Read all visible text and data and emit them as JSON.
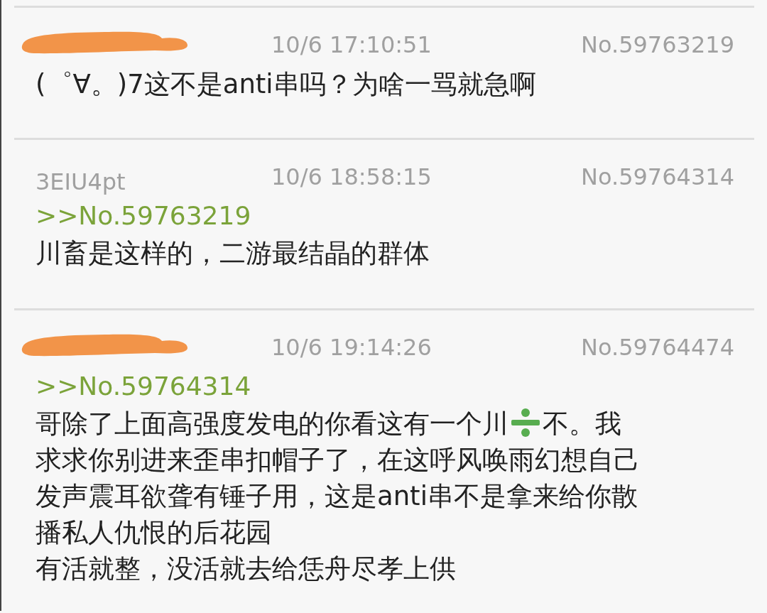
{
  "posts": [
    {
      "author": {
        "redacted": true
      },
      "time": "10/6 17:10:51",
      "number": "No.59763219",
      "lines": [
        [
          {
            "kind": "text",
            "text": "(゜∀。)7这不是anti串吗？为啥一骂就急啊"
          }
        ]
      ]
    },
    {
      "author": {
        "redacted": false,
        "name": "3EIU4pt"
      },
      "time": "10/6 18:58:15",
      "number": "No.59764314",
      "reply_to": ">>No.59763219",
      "lines": [
        [
          {
            "kind": "text",
            "text": "川畜是这样的，二游最结晶的群体"
          }
        ]
      ]
    },
    {
      "author": {
        "redacted": true
      },
      "time": "10/6 19:14:26",
      "number": "No.59764474",
      "reply_to": ">>No.59764314",
      "lines": [
        [
          {
            "kind": "text",
            "text": "哥除了上面高强度发电的你看这有一个川"
          },
          {
            "kind": "divide-emoji"
          },
          {
            "kind": "text",
            "text": "不。我"
          }
        ],
        [
          {
            "kind": "text",
            "text": "求求你别进来歪串扣帽子了，在这呼风唤雨幻想自己"
          }
        ],
        [
          {
            "kind": "text",
            "text": "发声震耳欲聋有锤子用，这是anti串不是拿来给你散"
          }
        ],
        [
          {
            "kind": "text",
            "text": "播私人仇恨的后花园"
          }
        ],
        [
          {
            "kind": "text",
            "text": "有活就整，没活就去给恁舟尽孝上供"
          }
        ]
      ]
    }
  ]
}
